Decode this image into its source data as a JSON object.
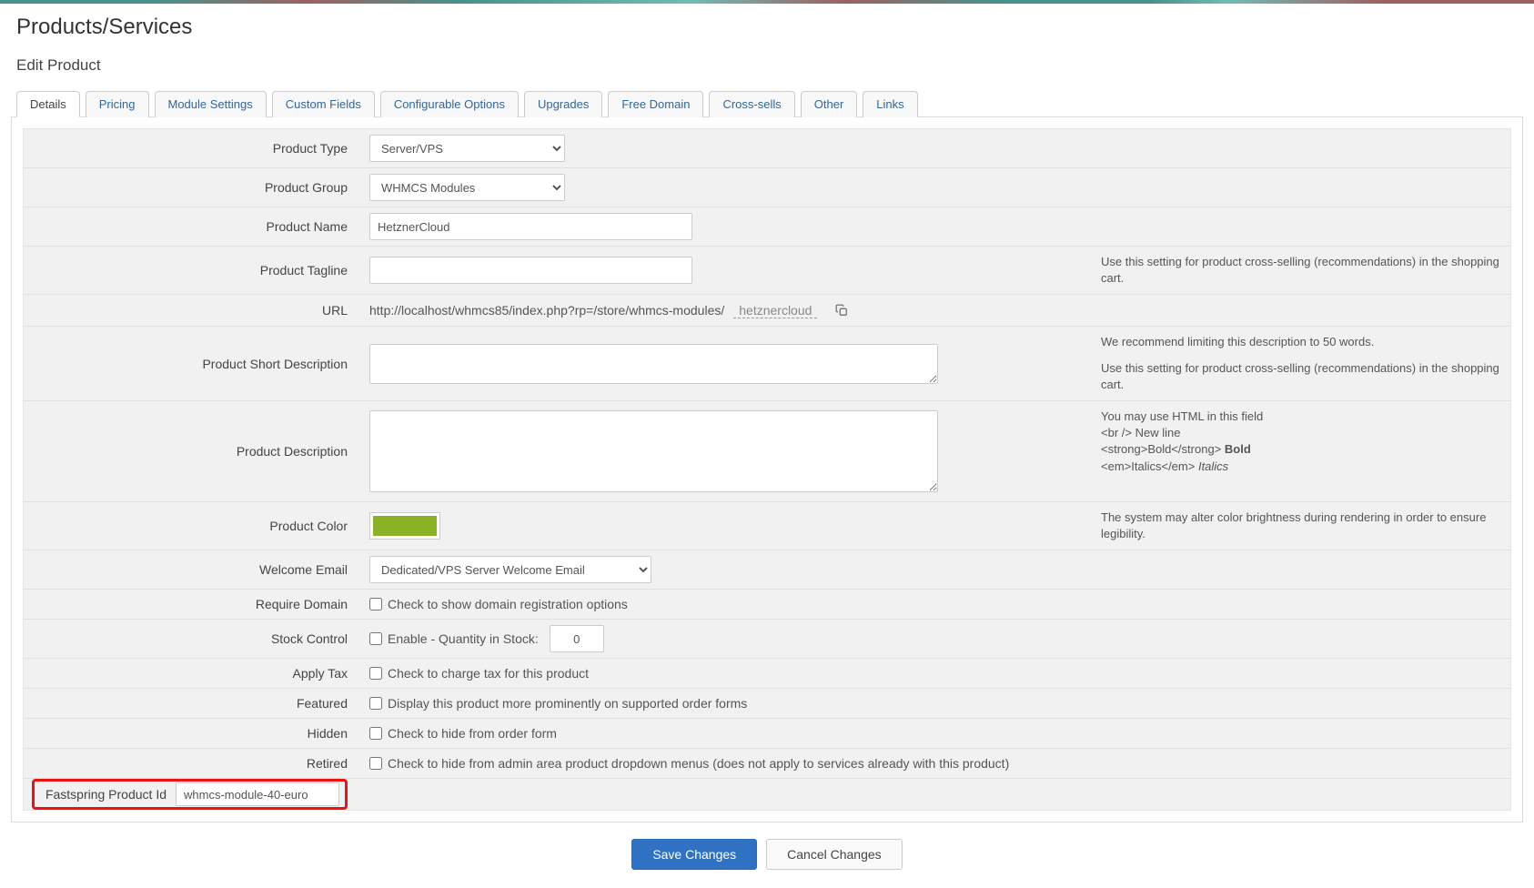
{
  "page": {
    "title": "Products/Services",
    "subtitle": "Edit Product"
  },
  "tabs": [
    {
      "label": "Details",
      "active": true
    },
    {
      "label": "Pricing"
    },
    {
      "label": "Module Settings"
    },
    {
      "label": "Custom Fields"
    },
    {
      "label": "Configurable Options"
    },
    {
      "label": "Upgrades"
    },
    {
      "label": "Free Domain"
    },
    {
      "label": "Cross-sells"
    },
    {
      "label": "Other"
    },
    {
      "label": "Links"
    }
  ],
  "labels": {
    "product_type": "Product Type",
    "product_group": "Product Group",
    "product_name": "Product Name",
    "product_tagline": "Product Tagline",
    "url": "URL",
    "short_desc": "Product Short Description",
    "description": "Product Description",
    "product_color": "Product Color",
    "welcome_email": "Welcome Email",
    "require_domain": "Require Domain",
    "stock_control": "Stock Control",
    "apply_tax": "Apply Tax",
    "featured": "Featured",
    "hidden": "Hidden",
    "retired": "Retired",
    "fastspring_id": "Fastspring Product Id"
  },
  "help": {
    "tagline": "Use this setting for product cross-selling (recommendations) in the shopping cart.",
    "short_desc_1": "We recommend limiting this description to 50 words.",
    "short_desc_2": "Use this setting for product cross-selling (recommendations) in the shopping cart.",
    "desc_line1": "You may use HTML in this field",
    "desc_line2a": "<br /> New line",
    "desc_line3a": "<strong>Bold</strong> ",
    "desc_line3b": "Bold",
    "desc_line4a": "<em>Italics</em> ",
    "desc_line4b": "Italics",
    "color": "The system may alter color brightness during rendering in order to ensure legibility."
  },
  "values": {
    "product_type": "Server/VPS",
    "product_group": "WHMCS Modules",
    "product_name": "HetznerCloud",
    "product_tagline": "",
    "url_base": "http://localhost/whmcs85/index.php?rp=/store/whmcs-modules/",
    "url_slug": "hetznercloud",
    "short_desc": "",
    "description": "",
    "product_color": "#8bb224",
    "welcome_email": "Dedicated/VPS Server Welcome Email",
    "require_domain_checked": false,
    "require_domain_label": "Check to show domain registration options",
    "stock_enable_checked": false,
    "stock_enable_label": "Enable - Quantity in Stock:",
    "stock_qty": "0",
    "apply_tax_checked": false,
    "apply_tax_label": "Check to charge tax for this product",
    "featured_checked": false,
    "featured_label": "Display this product more prominently on supported order forms",
    "hidden_checked": false,
    "hidden_label": "Check to hide from order form",
    "retired_checked": false,
    "retired_label": "Check to hide from admin area product dropdown menus (does not apply to services already with this product)",
    "fastspring_id": "whmcs-module-40-euro"
  },
  "buttons": {
    "save": "Save Changes",
    "cancel": "Cancel Changes"
  }
}
